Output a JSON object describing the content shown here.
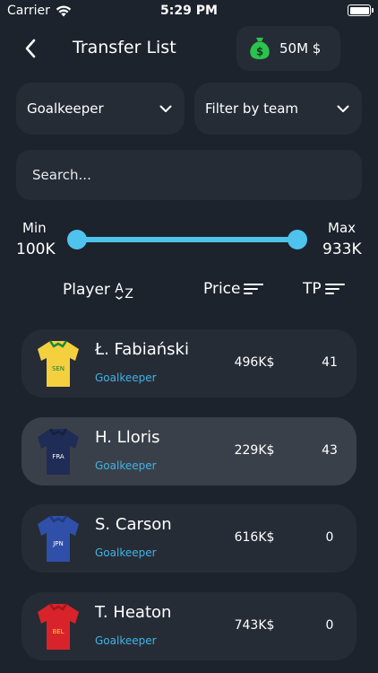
{
  "status_bar": {
    "carrier": "Carrier",
    "time": "5:29 PM"
  },
  "header": {
    "title": "Transfer List",
    "budget": "50M $",
    "budget_icon": "money-bag-icon",
    "back_icon": "chevron-left-icon"
  },
  "filters": {
    "position": "Goalkeeper",
    "team": "Filter by team"
  },
  "search": {
    "placeholder": "Search..."
  },
  "price_range": {
    "min_label": "Min",
    "min_value": "100K",
    "max_label": "Max",
    "max_value": "933K",
    "low_fraction": 0.0,
    "high_fraction": 1.0
  },
  "sort": {
    "player": "Player",
    "player_icon": "a-z",
    "price": "Price",
    "tp": "TP"
  },
  "colors": {
    "background": "#1d232c",
    "card": "#262c36",
    "card_selected": "#3a4049",
    "accent": "#4ec3ee",
    "money": "#2bc34f"
  },
  "players": [
    {
      "name": "Ł. Fabiański",
      "position": "Goalkeeper",
      "price": "496K$",
      "tp": "41",
      "jersey_code": "SEN",
      "jersey_color": "#f4d03f",
      "jersey_trim": "#1b8a3a",
      "jersey_text_color": "#1b7a3a",
      "selected": false
    },
    {
      "name": "H. Lloris",
      "position": "Goalkeeper",
      "price": "229K$",
      "tp": "43",
      "jersey_code": "FRA",
      "jersey_color": "#1f2c56",
      "jersey_trim": "#15203f",
      "jersey_text_color": "#ffffff",
      "selected": true
    },
    {
      "name": "S. Carson",
      "position": "Goalkeeper",
      "price": "616K$",
      "tp": "0",
      "jersey_code": "JPN",
      "jersey_color": "#2f4fa8",
      "jersey_trim": "#22397d",
      "jersey_text_color": "#ffffff",
      "selected": false
    },
    {
      "name": "T. Heaton",
      "position": "Goalkeeper",
      "price": "743K$",
      "tp": "0",
      "jersey_code": "BEL",
      "jersey_color": "#d8232a",
      "jersey_trim": "#a3181d",
      "jersey_text_color": "#f7d23b",
      "selected": false
    }
  ]
}
